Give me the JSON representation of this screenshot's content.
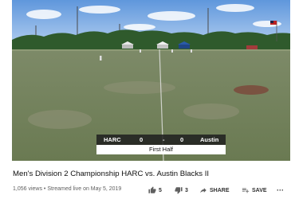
{
  "video": {
    "scoreboard": {
      "home_team": "HARC",
      "home_score": "0",
      "separator": "-",
      "away_score": "0",
      "away_team": "Austin",
      "period": "First Half"
    }
  },
  "title": "Men's Division 2 Championship HARC vs. Austin Blacks II",
  "meta": {
    "views": "1,056 views",
    "dot": "•",
    "streamed": "Streamed live on May 5, 2019"
  },
  "actions": {
    "like_count": "5",
    "dislike_count": "3",
    "share_label": "SHARE",
    "save_label": "SAVE",
    "more_label": "···"
  },
  "icons": [
    "thumbs-up-icon",
    "thumbs-down-icon",
    "share-icon",
    "save-playlist-icon",
    "more-icon"
  ]
}
